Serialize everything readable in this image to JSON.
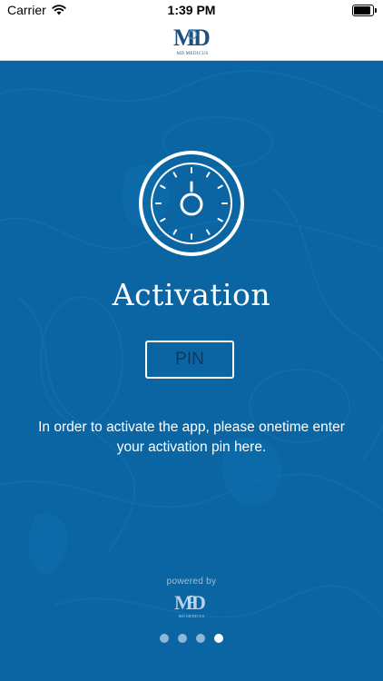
{
  "status_bar": {
    "carrier": "Carrier",
    "time": "1:39 PM",
    "icons": [
      "wifi-icon",
      "battery-icon"
    ]
  },
  "header": {
    "logo_text": "MD MEDICUS"
  },
  "activation": {
    "title": "Activation",
    "pin_placeholder": "PIN",
    "instructions": "In order to activate the app, please onetime enter your activation pin here."
  },
  "footer": {
    "powered_by": "powered by",
    "logo_text": "MD MEDICUS"
  },
  "pagination": {
    "count": 4,
    "active_index": 3
  },
  "colors": {
    "brand_blue": "#0b65a3",
    "logo_blue": "#1f4f7f",
    "input_text": "#0a3a63",
    "white": "#ffffff"
  }
}
